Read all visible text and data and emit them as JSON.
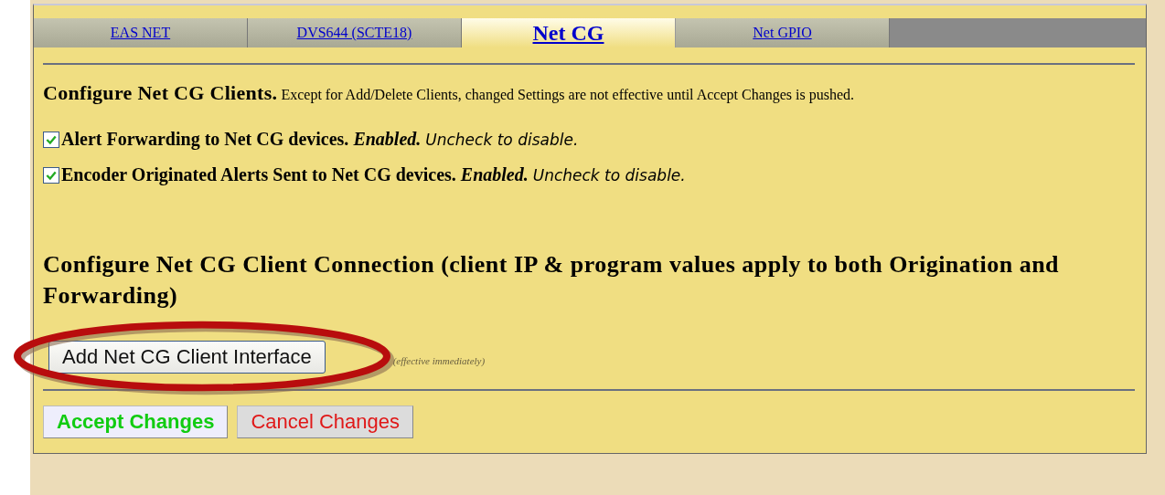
{
  "tabs": [
    {
      "label": "EAS NET",
      "selected": false
    },
    {
      "label": "DVS644 (SCTE18)",
      "selected": false
    },
    {
      "label": "Net CG",
      "selected": true
    },
    {
      "label": "Net GPIO",
      "selected": false
    }
  ],
  "clients_heading": {
    "title": "Configure Net CG Clients.",
    "note": "Except for Add/Delete Clients, changed Settings are not effective until Accept Changes is pushed."
  },
  "options": [
    {
      "label": "Alert Forwarding to Net CG devices.",
      "status": "Enabled.",
      "hint": "Uncheck to disable.",
      "checked": true
    },
    {
      "label": "Encoder Originated Alerts Sent to Net CG devices.",
      "status": "Enabled.",
      "hint": "Uncheck to disable.",
      "checked": true
    }
  ],
  "connection_heading": "Configure Net CG Client Connection (client IP & program values apply to both Origination and Forwarding)",
  "add_button": {
    "label": "Add Net CG Client Interface",
    "note": "(effective immediately)",
    "highlighted": true
  },
  "accept_button": "Accept Changes",
  "cancel_button": "Cancel Changes"
}
